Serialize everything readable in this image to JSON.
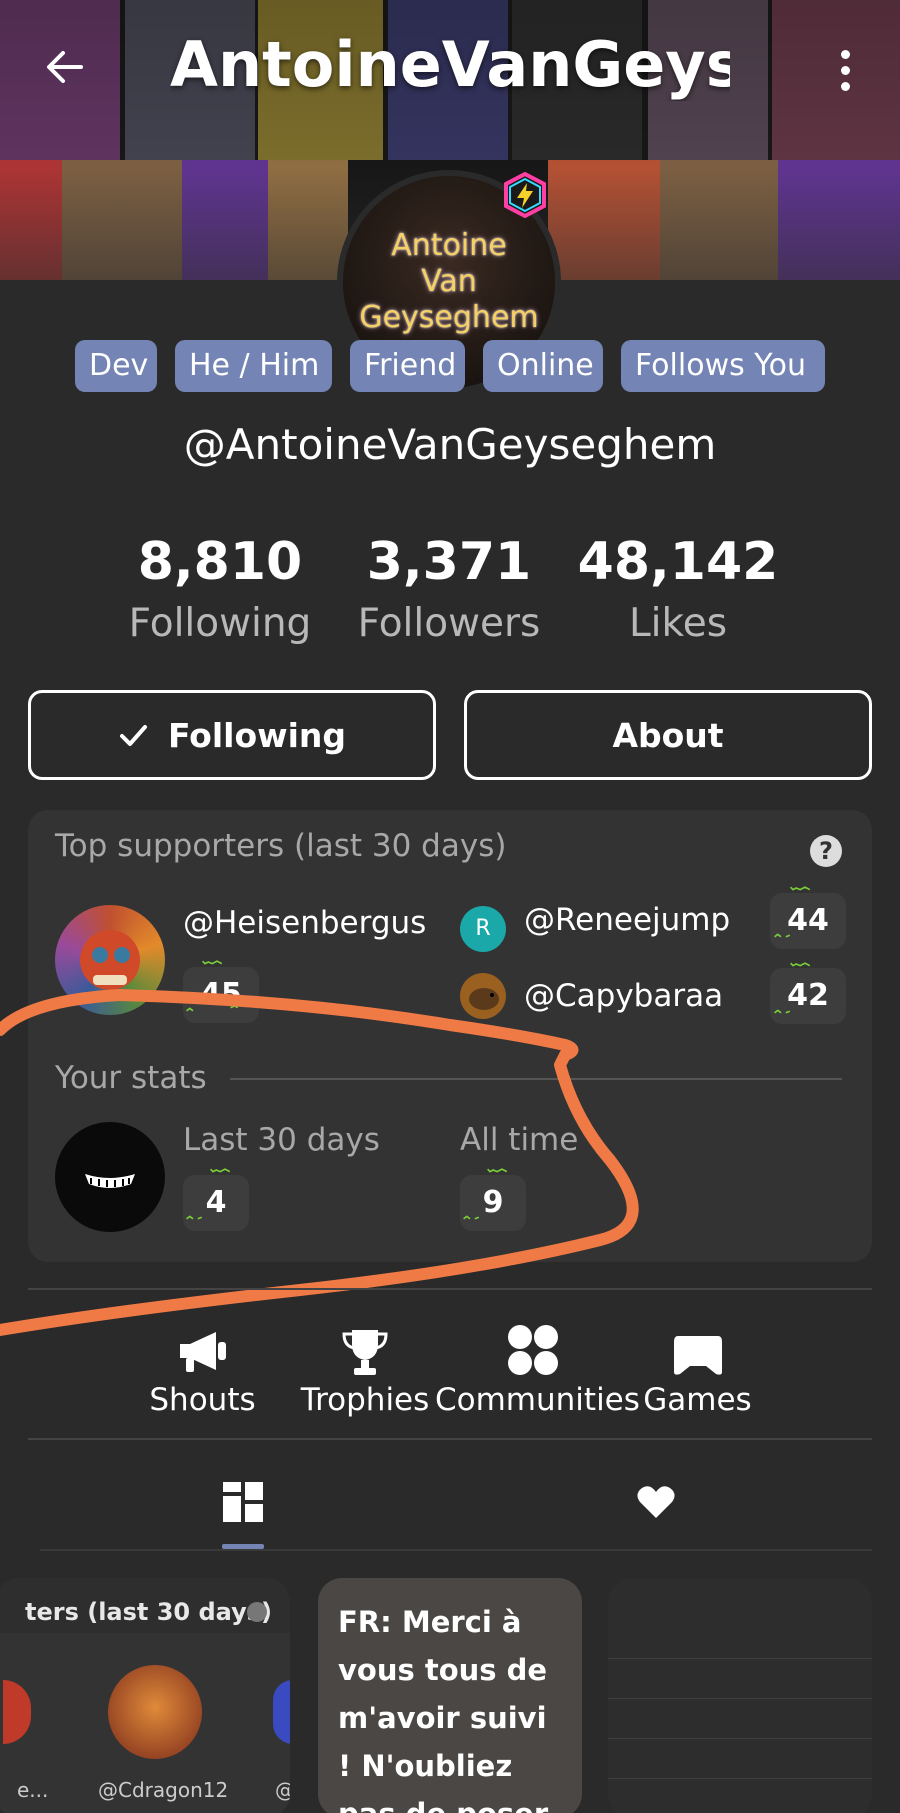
{
  "header": {
    "title": "AntoineVanGeysegh",
    "back_icon": "arrow-left-icon",
    "more_icon": "more-vertical-icon"
  },
  "avatar": {
    "lines": [
      "Antoine",
      "Van",
      "Geyseghem"
    ],
    "badge_icon": "hexagon-bolt-icon"
  },
  "tags": [
    "Dev",
    "He / Him",
    "Friend",
    "Online",
    "Follows You"
  ],
  "handle": "@AntoineVanGeyseghem",
  "stats": [
    {
      "value": "8,810",
      "label": "Following"
    },
    {
      "value": "3,371",
      "label": "Followers"
    },
    {
      "value": "48,142",
      "label": "Likes"
    }
  ],
  "buttons": {
    "following_label": "Following",
    "about_label": "About"
  },
  "supporters": {
    "heading": "Top supporters (last 30 days)",
    "help_glyph": "?",
    "top": {
      "name": "@Heisenbergus",
      "count": "45"
    },
    "others": [
      {
        "name": "@Reneejump",
        "count": "44",
        "avatar_letter": "R"
      },
      {
        "name": "@Capybaraa",
        "count": "42"
      }
    ]
  },
  "your_stats": {
    "heading": "Your stats",
    "last30_label": "Last 30 days",
    "last30_value": "4",
    "alltime_label": "All time",
    "alltime_value": "9"
  },
  "nav": [
    {
      "label": "Shouts",
      "icon": "megaphone-icon"
    },
    {
      "label": "Trophies",
      "icon": "trophy-icon"
    },
    {
      "label": "Communities",
      "icon": "communities-icon"
    },
    {
      "label": "Games",
      "icon": "gamepad-icon"
    }
  ],
  "tabs": [
    {
      "icon": "grid-icon",
      "active": true
    },
    {
      "icon": "heart-icon",
      "active": false
    }
  ],
  "posts": {
    "post1": {
      "heading": "ters (last 30 days)",
      "name_left": "e...",
      "name_center": "@Cdragon12",
      "name_right": "@"
    },
    "post2": {
      "text": "FR: Merci à vous tous de m'avoir suivi ! N'oubliez pas de poser un"
    }
  },
  "colors": {
    "background": "#2a2a2a",
    "card": "#333333",
    "tag": "#7484b4",
    "annotation": "#f07a45"
  }
}
